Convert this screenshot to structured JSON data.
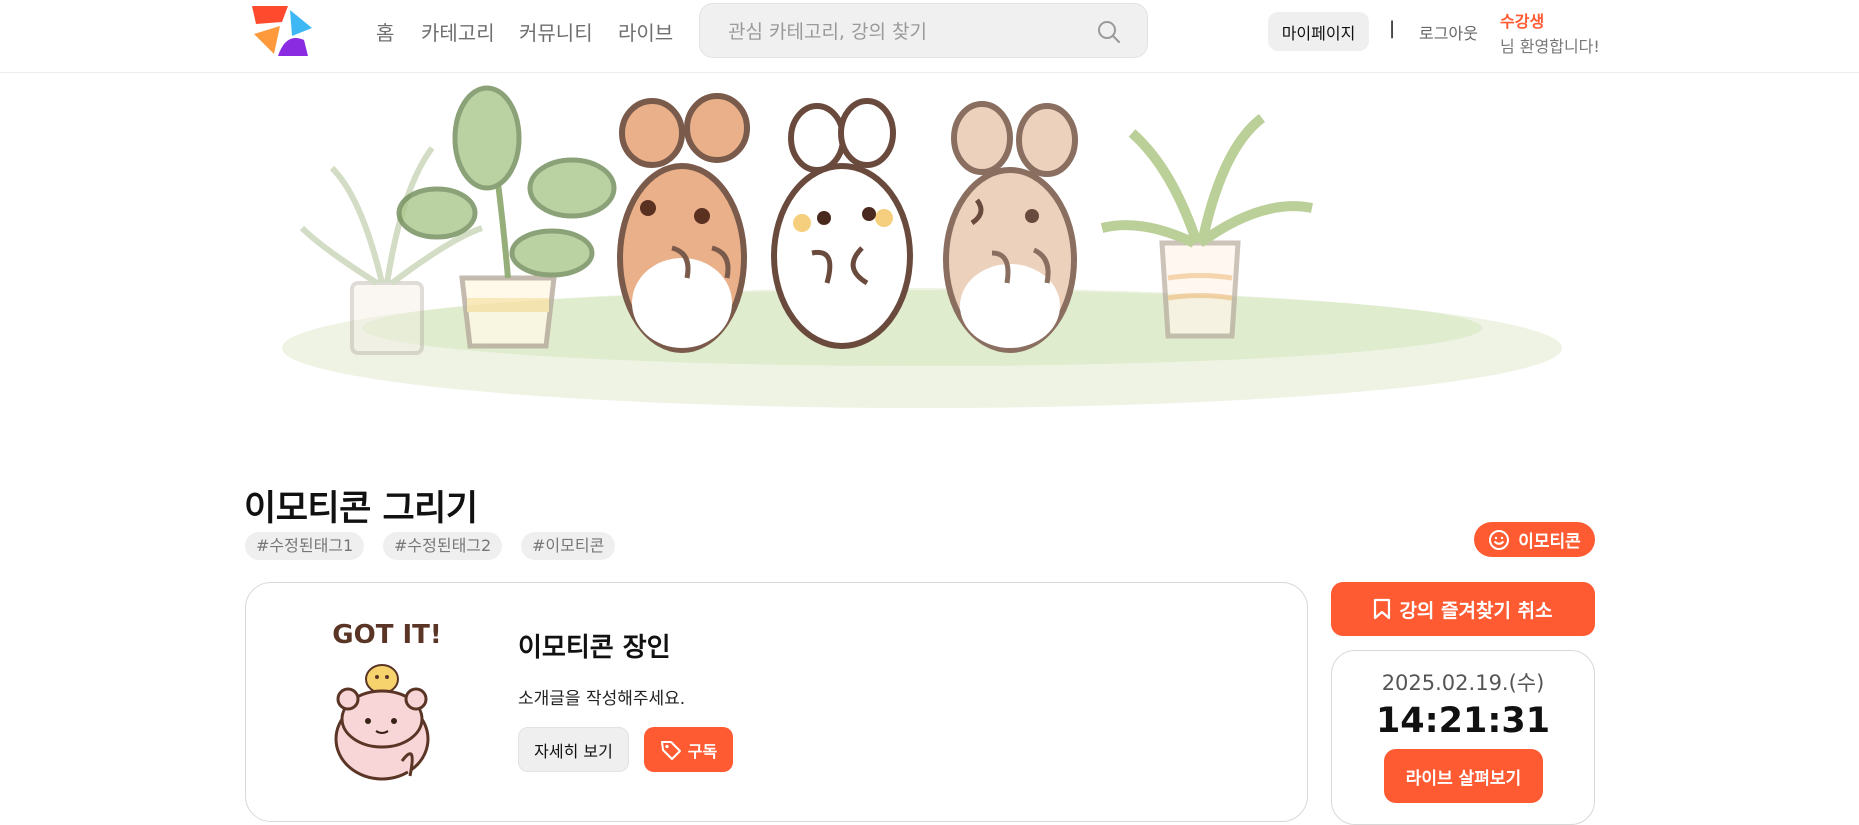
{
  "header": {
    "nav": [
      "홈",
      "카테고리",
      "커뮤니티",
      "라이브"
    ],
    "search_placeholder": "관심 카테고리, 강의 찾기",
    "mypage_label": "마이페이지",
    "divider": "|",
    "logout_label": "로그아웃",
    "user_role": "수강생",
    "greeting": "님 환영합니다!"
  },
  "course": {
    "title": "이모티콘 그리기",
    "tags": [
      "#수정된태그1",
      "#수정된태그2",
      "#이모티콘"
    ],
    "category": "이모티콘"
  },
  "instructor": {
    "name": "이모티콘 장인",
    "intro": "소개글을 작성해주세요.",
    "detail_label": "자세히 보기",
    "subscribe_label": "구독",
    "avatar_caption": "GOT IT!"
  },
  "sidebar": {
    "favorite_label": "강의 즐겨찾기 취소",
    "live_date": "2025.02.19.(수)",
    "live_time": "14:21:31",
    "live_button": "라이브 살펴보기"
  },
  "colors": {
    "accent": "#ff5b33",
    "logo_red": "#ff4a2e",
    "logo_blue": "#3db8f5",
    "logo_orange": "#ff9a3c",
    "logo_purple": "#8a2be2"
  },
  "icons": {
    "search": "search-icon",
    "bookmark": "bookmark-icon",
    "tag": "tag-icon",
    "category": "smile-icon"
  }
}
